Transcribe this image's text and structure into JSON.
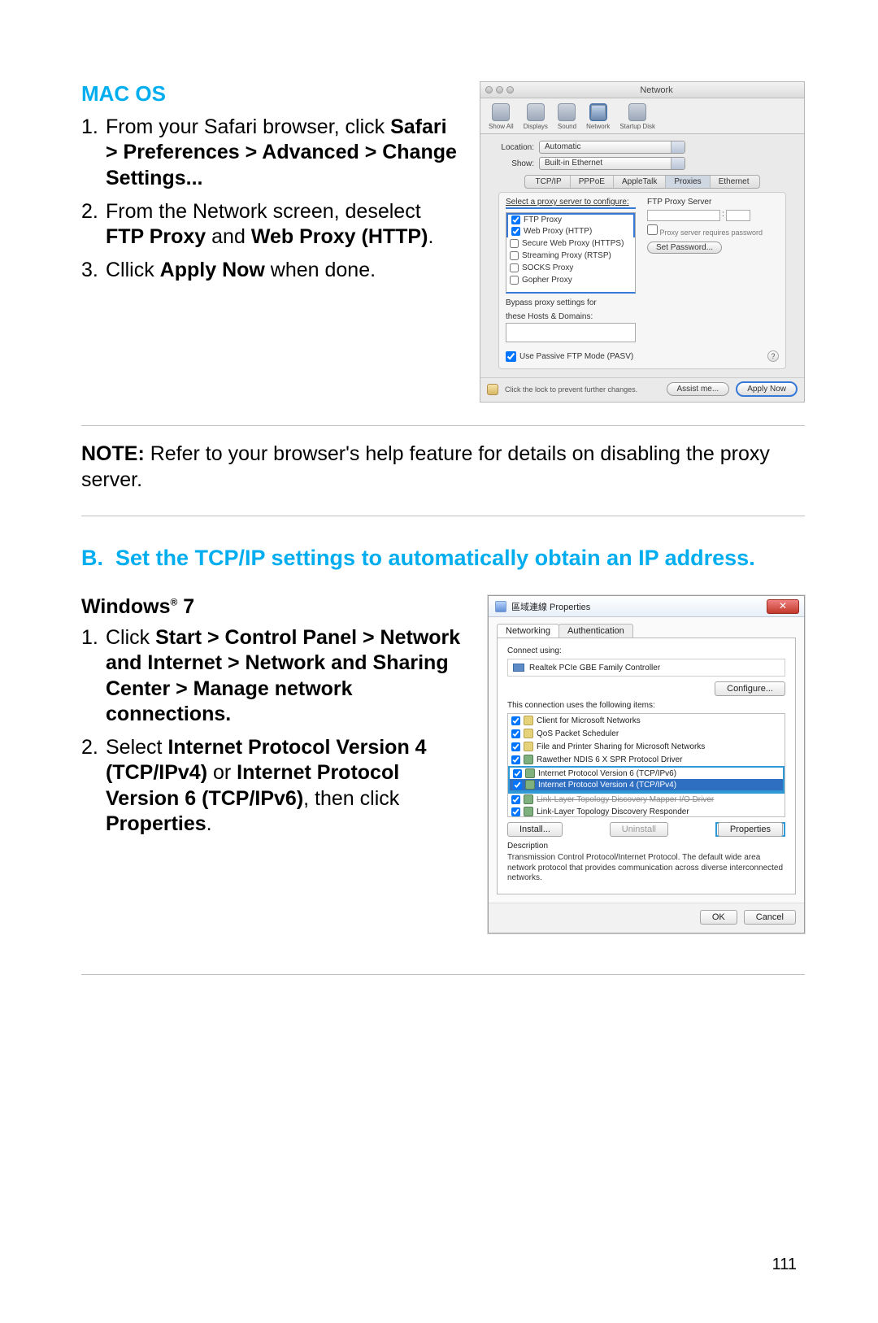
{
  "mac_heading": "MAC OS",
  "mac_steps": {
    "s1a": "From your Safari browser, click ",
    "s1b": "Safari > Preferences > Advanced > Change Settings...",
    "s2a": "From the Network screen, deselect ",
    "s2b": "FTP Proxy",
    "s2c": " and ",
    "s2d": "Web Proxy (HTTP)",
    "s2e": ".",
    "s3a": "Cllick ",
    "s3b": "Apply Now",
    "s3c": " when done."
  },
  "note_label": "NOTE:",
  "note_text": " Refer to your browser's help feature for details on disabling the proxy server.",
  "section_b_label": "B.",
  "section_b_text": "Set the TCP/IP settings to automatically obtain an IP address.",
  "win_heading_a": "Windows",
  "win_heading_b": " 7",
  "win_steps": {
    "s1a": "Click ",
    "s1b": "Start > Control Panel > Network and Internet > Network and Sharing Center > Manage network connections.",
    "s2a": "Select ",
    "s2b": "Internet Protocol Version 4 (TCP/IPv4)",
    "s2c": " or ",
    "s2d": "Internet Protocol Version 6 (TCP/IPv6)",
    "s2e": ", then click ",
    "s2f": "Properties",
    "s2g": "."
  },
  "page_number": "111",
  "macshot": {
    "title": "Network",
    "toolbar": [
      "Show All",
      "Displays",
      "Sound",
      "Network",
      "Startup Disk"
    ],
    "location_lbl": "Location:",
    "location_val": "Automatic",
    "show_lbl": "Show:",
    "show_val": "Built-in Ethernet",
    "tabs": [
      "TCP/IP",
      "PPPoE",
      "AppleTalk",
      "Proxies",
      "Ethernet"
    ],
    "proxy_select_label": "Select a proxy server to configure:",
    "proxies": [
      "FTP Proxy",
      "Web Proxy (HTTP)",
      "Secure Web Proxy (HTTPS)",
      "Streaming Proxy (RTSP)",
      "SOCKS Proxy",
      "Gopher Proxy"
    ],
    "right_header": "FTP Proxy Server",
    "pw_text": "Proxy server requires password",
    "setpw": "Set Password...",
    "bypass1": "Bypass proxy settings for",
    "bypass2": "these Hosts & Domains:",
    "pasv": "Use Passive FTP Mode (PASV)",
    "lock_text": "Click the lock to prevent further changes.",
    "assist": "Assist me...",
    "apply": "Apply Now"
  },
  "winshot": {
    "title": "區域連線 Properties",
    "tab1": "Networking",
    "tab2": "Authentication",
    "connect_lbl": "Connect using:",
    "adapter": "Realtek PCIe GBE Family Controller",
    "configure": "Configure...",
    "items_lbl": "This connection uses the following items:",
    "items": [
      "Client for Microsoft Networks",
      "QoS Packet Scheduler",
      "File and Printer Sharing for Microsoft Networks",
      "Rawether NDIS 6 X SPR Protocol Driver",
      "Internet Protocol Version 6 (TCP/IPv6)",
      "Internet Protocol Version 4 (TCP/IPv4)",
      "Link-Layer Topology Discovery Mapper I/O Driver",
      "Link-Layer Topology Discovery Responder"
    ],
    "install": "Install...",
    "uninstall": "Uninstall",
    "properties": "Properties",
    "desc_lbl": "Description",
    "desc_text": "Transmission Control Protocol/Internet Protocol. The default wide area network protocol that provides communication across diverse interconnected networks.",
    "ok": "OK",
    "cancel": "Cancel"
  }
}
